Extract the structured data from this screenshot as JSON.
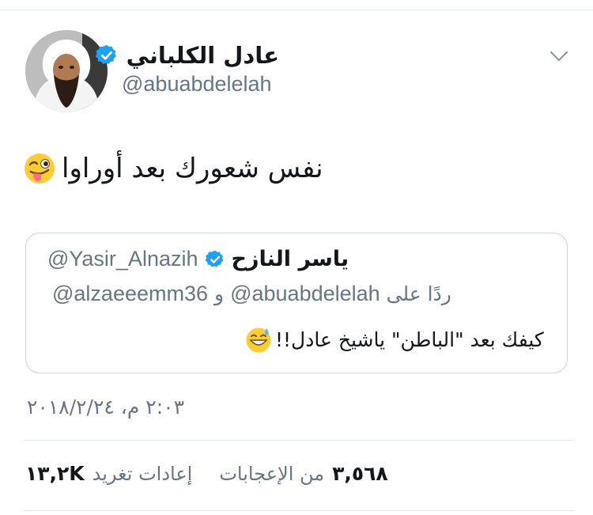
{
  "tweet": {
    "author": {
      "display_name": "عادل الكلباني",
      "handle": "@abuabdelelah",
      "verified": true
    },
    "text": "نفس شعورك بعد أوراوا",
    "text_emoji": "winking-face-with-tongue",
    "timestamp": "٢:٠٣ م، ٢٠١٨/٢/٢٤"
  },
  "quoted_tweet": {
    "display_name": "ياسر النازح",
    "handle": "@Yasir_Alnazih",
    "verified": true,
    "replying_label": "ردًا على",
    "replying_handle_1": "@abuabdelelah",
    "replying_joiner": "و",
    "replying_handle_2": "@alzaeeemm36",
    "text": "كيفك بعد \"الباطن\" ياشيخ عادل!!",
    "text_emoji": "grinning-face-with-sweat"
  },
  "stats": {
    "retweets_count": "١٣,٢K",
    "retweets_label": "إعادات تغريد",
    "likes_count": "٣,٥٦٨",
    "likes_label": "من الإعجابات"
  },
  "colors": {
    "verified_blue": "#1da1f2",
    "secondary_text": "#657786",
    "border": "#ccd6dd"
  }
}
